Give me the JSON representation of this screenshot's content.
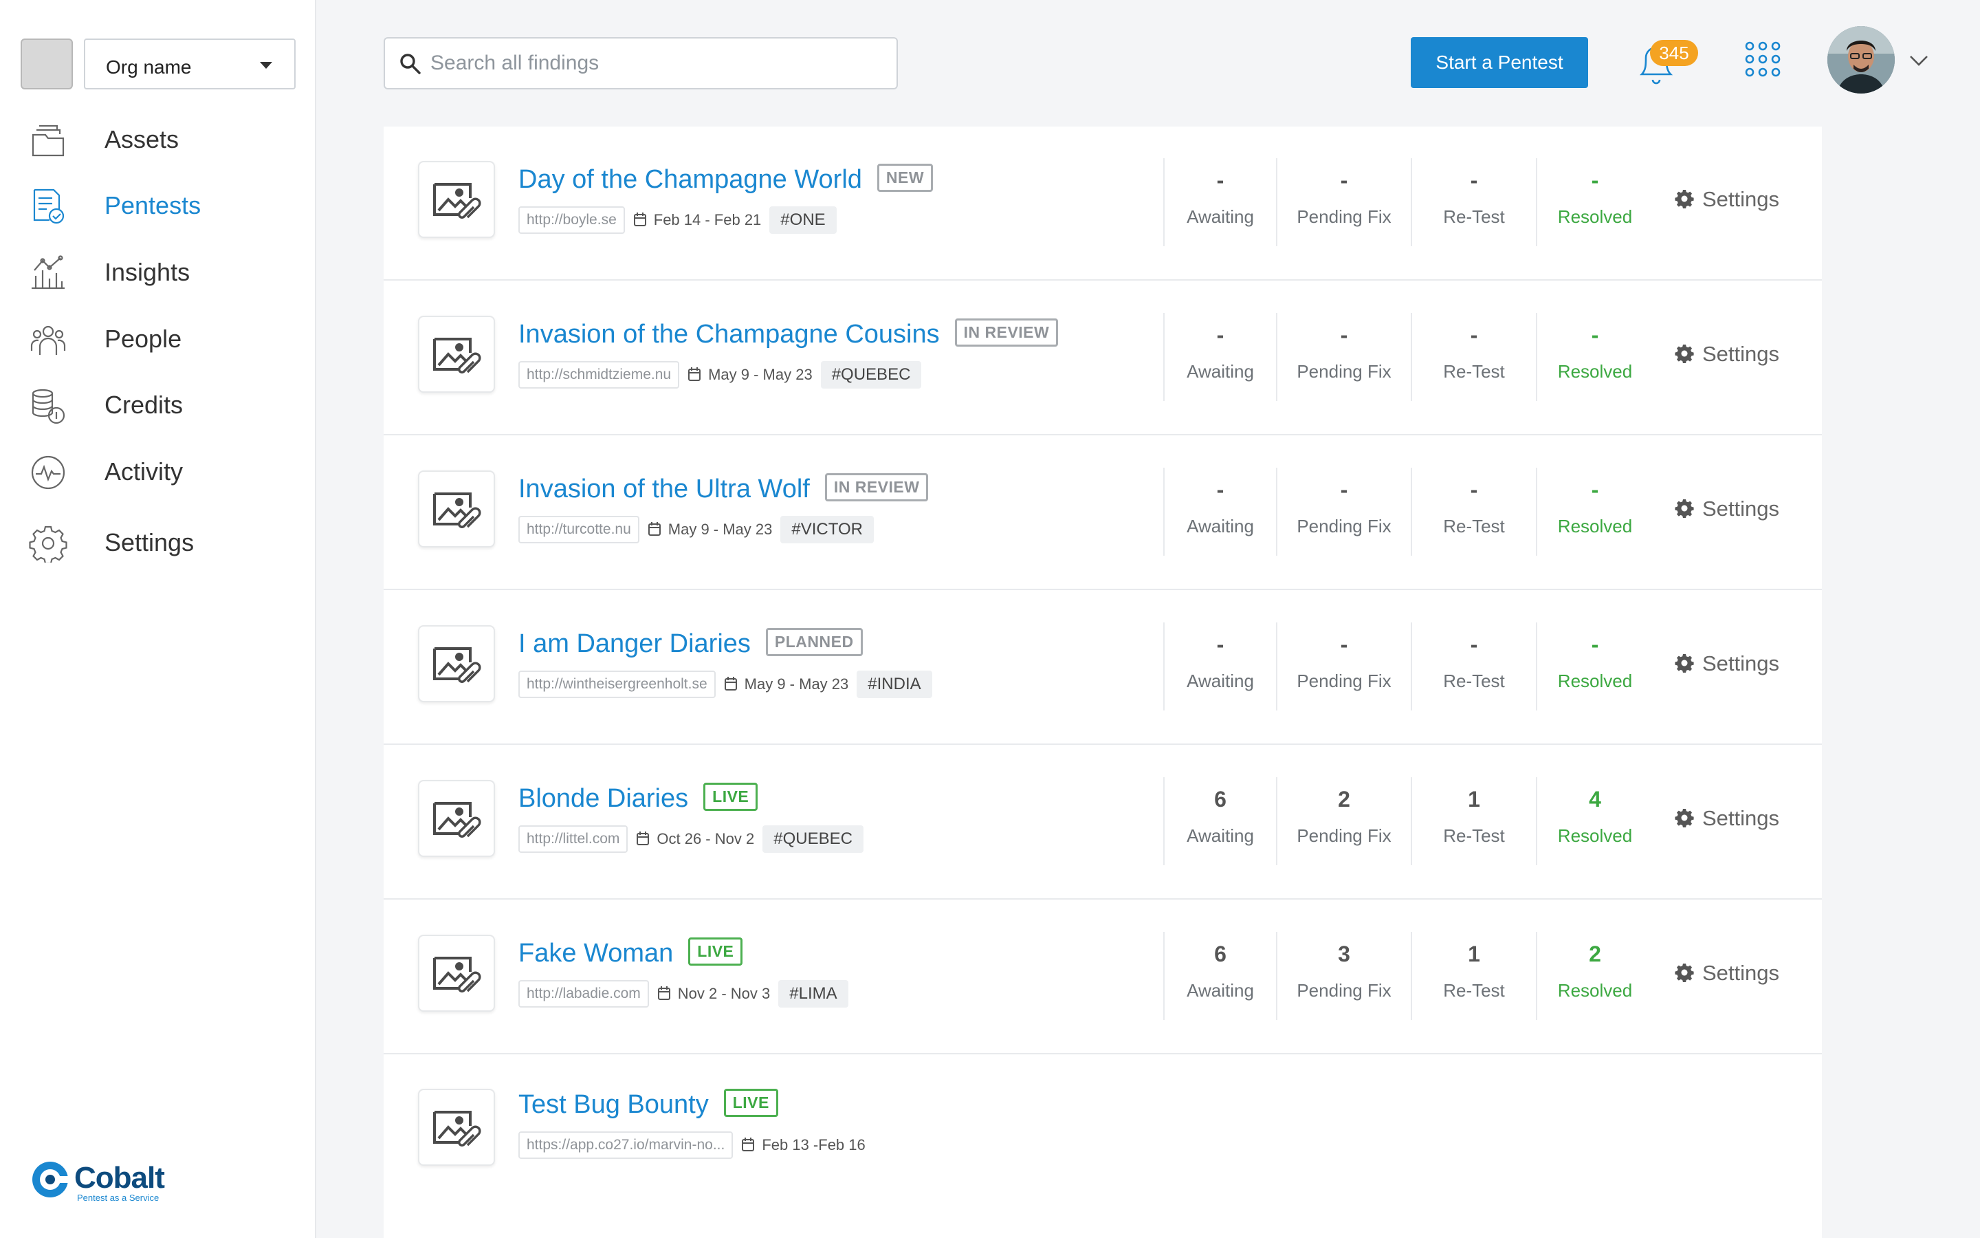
{
  "org": {
    "selected": "Org name"
  },
  "nav": [
    {
      "label": "Assets",
      "icon": "folder-icon"
    },
    {
      "label": "Pentests",
      "icon": "report-check-icon"
    },
    {
      "label": "Insights",
      "icon": "chart-icon"
    },
    {
      "label": "People",
      "icon": "people-icon"
    },
    {
      "label": "Credits",
      "icon": "coins-icon"
    },
    {
      "label": "Activity",
      "icon": "pulse-icon"
    },
    {
      "label": "Settings",
      "icon": "gear-icon"
    }
  ],
  "active_nav": "Pentests",
  "brand": {
    "name": "Cobalt",
    "tagline": "Pentest as a Service"
  },
  "search": {
    "placeholder": "Search all findings",
    "value": ""
  },
  "header": {
    "start_button": "Start a Pentest",
    "notification_count": "345"
  },
  "colors": {
    "accent": "#1a87d0",
    "live": "#3ca841",
    "badge": "#f4a322"
  },
  "stat_labels": {
    "awaiting": "Awaiting",
    "pending": "Pending Fix",
    "retest": "Re-Test",
    "resolved": "Resolved"
  },
  "settings_label": "Settings",
  "pentests": [
    {
      "title": "Day of the Champagne World",
      "status": "NEW",
      "url": "http://boyle.se",
      "dates": "Feb 14 - Feb 21",
      "tag": "#ONE",
      "awaiting": "-",
      "pending": "-",
      "retest": "-",
      "resolved": "-"
    },
    {
      "title": "Invasion of the Champagne Cousins",
      "status": "IN REVIEW",
      "url": "http://schmidtzieme.nu",
      "dates": "May 9 - May 23",
      "tag": "#QUEBEC",
      "awaiting": "-",
      "pending": "-",
      "retest": "-",
      "resolved": "-"
    },
    {
      "title": "Invasion of the Ultra Wolf",
      "status": "IN REVIEW",
      "url": "http://turcotte.nu",
      "dates": "May 9 - May 23",
      "tag": "#VICTOR",
      "awaiting": "-",
      "pending": "-",
      "retest": "-",
      "resolved": "-"
    },
    {
      "title": "I am Danger Diaries",
      "status": "PLANNED",
      "url": "http://wintheisergreenholt.se",
      "dates": "May 9 - May 23",
      "tag": "#INDIA",
      "awaiting": "-",
      "pending": "-",
      "retest": "-",
      "resolved": "-"
    },
    {
      "title": "Blonde Diaries",
      "status": "LIVE",
      "url": "http://littel.com",
      "dates": "Oct 26 - Nov 2",
      "tag": "#QUEBEC",
      "awaiting": "6",
      "pending": "2",
      "retest": "1",
      "resolved": "4"
    },
    {
      "title": "Fake Woman",
      "status": "LIVE",
      "url": "http://labadie.com",
      "dates": "Nov 2 - Nov 3",
      "tag": "#LIMA",
      "awaiting": "6",
      "pending": "3",
      "retest": "1",
      "resolved": "2"
    },
    {
      "title": "Test Bug Bounty",
      "status": "LIVE",
      "url": "https://app.co27.io/marvin-no...",
      "dates": "Feb 13 -Feb 16"
    }
  ]
}
